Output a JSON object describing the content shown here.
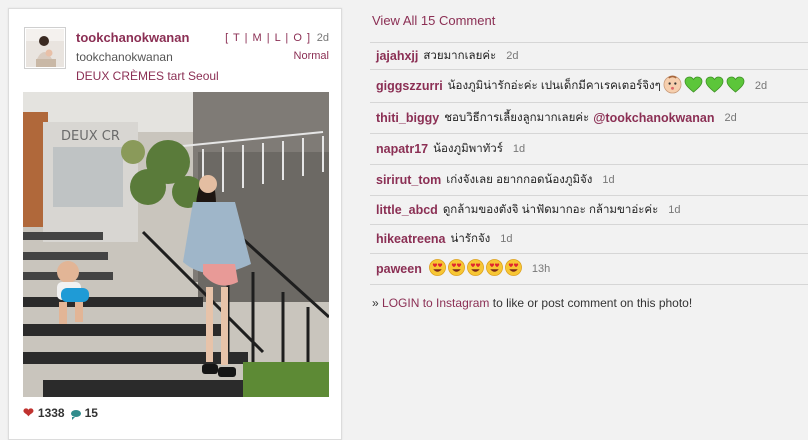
{
  "post": {
    "username": "tookchanokwanan",
    "full_name": "tookchanokwanan",
    "location": "DEUX CRÈMES tart Seoul",
    "tlmo": "[ T | M | L | O ]",
    "age": "2d",
    "filter": "Normal",
    "likes": "1338",
    "comments_count": "15",
    "photo_sign_text": "DEUX CR"
  },
  "comments_header": {
    "view_all": "View All 15 Comment"
  },
  "comments": [
    {
      "user": "jajahxjj",
      "text": "สวยมากเลยค่ะ",
      "age": "2d",
      "row_h": 26
    },
    {
      "user": "giggszzurri",
      "text": "น้องภูมิน่ารักอ่ะค่ะ เปนเด็กมีคาเรคเตอร์จิงๆ",
      "emoji": [
        "baby-face",
        "green-heart",
        "green-heart",
        "green-heart"
      ],
      "age": "2d",
      "row_h": 32
    },
    {
      "user": "thiti_biggy",
      "text": "ชอบวิธีการเลี้ยงลูกมากเลยค่ะ",
      "mention": "@tookchanokwanan",
      "age": "2d",
      "row_h": 30
    },
    {
      "user": "napatr17",
      "text": "น้องภูมิพาทัวร์",
      "age": "1d",
      "row_h": 30
    },
    {
      "user": "sirirut_tom",
      "text": "เก่งจังเลย อยากกอดน้องภูมิจัง",
      "age": "1d",
      "row_h": 30
    },
    {
      "user": "little_abcd",
      "text": "ดูกล้ามของตังจิ น่าฟัดมากอะ กล้ามขาอ่ะค่ะ",
      "age": "1d",
      "row_h": 28
    },
    {
      "user": "hikeatreena",
      "text": "น่ารักจัง",
      "age": "1d",
      "row_h": 28
    },
    {
      "user": "paween",
      "text": "",
      "emoji": [
        "heart-eyes",
        "heart-eyes",
        "heart-eyes",
        "heart-eyes",
        "heart-eyes"
      ],
      "age": "13h",
      "row_h": 30
    }
  ],
  "login": {
    "prefix": "»",
    "link": "LOGIN to Instagram",
    "suffix": "to like or post comment on this photo!"
  },
  "colors": {
    "accent": "#8b2f54",
    "heart": "#c0322f",
    "comment_icon": "#2f8c8c"
  }
}
